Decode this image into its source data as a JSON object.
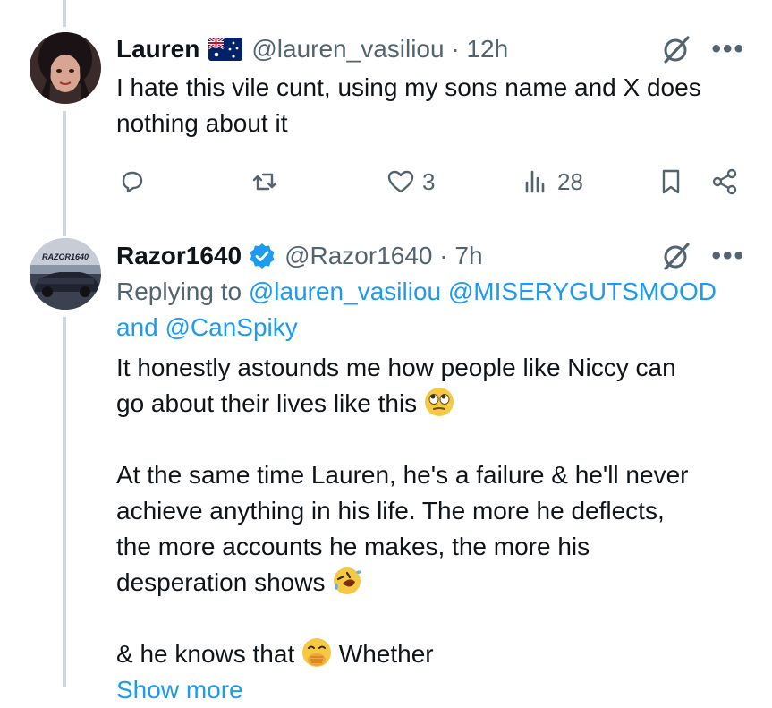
{
  "tweet1": {
    "display_name": "Lauren",
    "flag": "australia-flag",
    "handle": "@lauren_vasiliou",
    "time": "12h",
    "text_line1": "I hate this vile cunt, using my sons name and X does",
    "text_line2": "nothing about it",
    "reply_count": "",
    "retweet_count": "",
    "like_count": "3",
    "views_count": "28"
  },
  "tweet2": {
    "display_name": "Razor1640",
    "handle": "@Razor1640",
    "time": "7h",
    "reply_prefix": "Replying to",
    "reply_mention1": "@lauren_vasiliou",
    "reply_mention2": "@MISERYGUTSMOOD",
    "reply_and": "and",
    "reply_mention3": "@CanSpiky",
    "p1_line1": "It honestly astounds me how people like Niccy can",
    "p1_line2": "go about their lives like this",
    "p2_line1": "At the same time Lauren, he's a failure & he'll never",
    "p2_line2": "achieve anything in his life. The more he deflects,",
    "p2_line3": "the more accounts he makes, the more his",
    "p2_line4": "desperation shows",
    "p3_line1a": "& he knows that",
    "p3_line1b": "Whether",
    "show_more": "Show more",
    "avatar_text": "RAZOR1640"
  },
  "separator": " · ",
  "colors": {
    "link": "#1d9bf0",
    "muted": "#536471",
    "verified": "#1d9bf0",
    "thread": "#cfd9de"
  }
}
